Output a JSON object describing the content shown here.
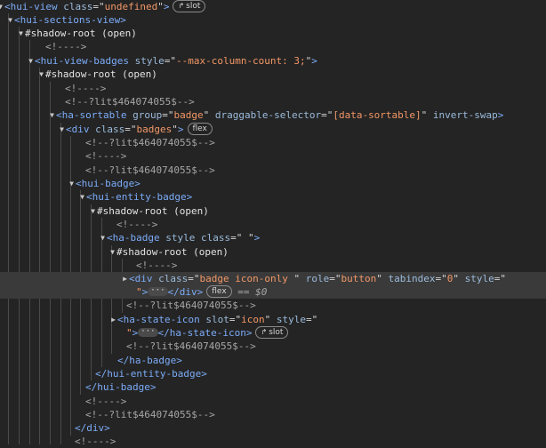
{
  "lines": [
    {
      "tri": "open",
      "parts": [
        {
          "c": "tag",
          "t": "<hui-view"
        },
        {
          "c": "attr",
          "t": " class"
        },
        {
          "c": "plain",
          "t": "=\""
        },
        {
          "c": "val",
          "t": "undefined"
        },
        {
          "c": "plain",
          "t": "\""
        },
        {
          "c": "tag",
          "t": ">"
        }
      ],
      "badge": "slot",
      "badge_icon": "↱"
    },
    {
      "tri": "open",
      "parts": [
        {
          "c": "tag",
          "t": "<hui-sections-view>"
        }
      ]
    },
    {
      "tri": "open",
      "parts": [
        {
          "c": "sr",
          "t": "#shadow-root (open)"
        }
      ]
    },
    {
      "tri": "",
      "parts": [
        {
          "c": "comment",
          "t": "<!---->"
        }
      ]
    },
    {
      "tri": "open",
      "parts": [
        {
          "c": "tag",
          "t": "<hui-view-badges"
        },
        {
          "c": "attr",
          "t": " style"
        },
        {
          "c": "plain",
          "t": "=\""
        },
        {
          "c": "val",
          "t": "--max-column-count: 3;"
        },
        {
          "c": "plain",
          "t": "\""
        },
        {
          "c": "tag",
          "t": ">"
        }
      ]
    },
    {
      "tri": "open",
      "parts": [
        {
          "c": "sr",
          "t": "#shadow-root (open)"
        }
      ]
    },
    {
      "tri": "",
      "parts": [
        {
          "c": "comment",
          "t": "<!---->"
        }
      ]
    },
    {
      "tri": "",
      "parts": [
        {
          "c": "comment",
          "t": "<!--?lit$464074055$-->"
        }
      ]
    },
    {
      "tri": "open",
      "parts": [
        {
          "c": "tag",
          "t": "<ha-sortable"
        },
        {
          "c": "attr",
          "t": " group"
        },
        {
          "c": "plain",
          "t": "=\""
        },
        {
          "c": "val",
          "t": "badge"
        },
        {
          "c": "plain",
          "t": "\""
        },
        {
          "c": "attr",
          "t": " draggable-selector"
        },
        {
          "c": "plain",
          "t": "=\""
        },
        {
          "c": "val",
          "t": "[data-sortable]"
        },
        {
          "c": "plain",
          "t": "\""
        },
        {
          "c": "attr",
          "t": " invert-swap"
        },
        {
          "c": "tag",
          "t": ">"
        }
      ]
    },
    {
      "tri": "open",
      "parts": [
        {
          "c": "tag",
          "t": "<div"
        },
        {
          "c": "attr",
          "t": " class"
        },
        {
          "c": "plain",
          "t": "=\""
        },
        {
          "c": "val",
          "t": "badges"
        },
        {
          "c": "plain",
          "t": "\""
        },
        {
          "c": "tag",
          "t": ">"
        }
      ],
      "badge": "flex"
    },
    {
      "tri": "",
      "parts": [
        {
          "c": "comment",
          "t": "<!--?lit$464074055$-->"
        }
      ]
    },
    {
      "tri": "",
      "parts": [
        {
          "c": "comment",
          "t": "<!---->"
        }
      ]
    },
    {
      "tri": "",
      "parts": [
        {
          "c": "comment",
          "t": "<!--?lit$464074055$-->"
        }
      ]
    },
    {
      "tri": "open",
      "parts": [
        {
          "c": "tag",
          "t": "<hui-badge>"
        }
      ]
    },
    {
      "tri": "open",
      "parts": [
        {
          "c": "tag",
          "t": "<hui-entity-badge>"
        }
      ]
    },
    {
      "tri": "open",
      "parts": [
        {
          "c": "sr",
          "t": "#shadow-root (open)"
        }
      ]
    },
    {
      "tri": "",
      "parts": [
        {
          "c": "comment",
          "t": "<!---->"
        }
      ]
    },
    {
      "tri": "open",
      "parts": [
        {
          "c": "tag",
          "t": "<ha-badge"
        },
        {
          "c": "attr",
          "t": " style"
        },
        {
          "c": "attr",
          "t": " class"
        },
        {
          "c": "plain",
          "t": "=\""
        },
        {
          "c": "val",
          "t": "  "
        },
        {
          "c": "plain",
          "t": "\""
        },
        {
          "c": "tag",
          "t": ">"
        }
      ]
    },
    {
      "tri": "open",
      "parts": [
        {
          "c": "sr",
          "t": "#shadow-root (open)"
        }
      ]
    },
    {
      "tri": "",
      "parts": [
        {
          "c": "comment",
          "t": "<!---->"
        }
      ]
    },
    {
      "tri": "closed",
      "selected": true,
      "parts": [
        {
          "c": "tag",
          "t": "<div"
        },
        {
          "c": "attr",
          "t": " class"
        },
        {
          "c": "plain",
          "t": "=\""
        },
        {
          "c": "val",
          "t": "badge  icon-only "
        },
        {
          "c": "plain",
          "t": "\""
        },
        {
          "c": "attr",
          "t": " role"
        },
        {
          "c": "plain",
          "t": "=\""
        },
        {
          "c": "val",
          "t": "button"
        },
        {
          "c": "plain",
          "t": "\""
        },
        {
          "c": "attr",
          "t": " tabindex"
        },
        {
          "c": "plain",
          "t": "=\""
        },
        {
          "c": "val",
          "t": "0"
        },
        {
          "c": "plain",
          "t": "\""
        },
        {
          "c": "attr",
          "t": " style"
        },
        {
          "c": "plain",
          "t": "=\""
        }
      ]
    },
    {
      "tri": "",
      "selected": true,
      "parts": [
        {
          "c": "val",
          "t": "\""
        },
        {
          "c": "tag",
          "t": ">"
        },
        {
          "c": "ellipsis",
          "t": "···"
        },
        {
          "c": "tag",
          "t": "</div>"
        }
      ],
      "badge": "flex",
      "suffix": " == $0"
    },
    {
      "tri": "",
      "parts": [
        {
          "c": "comment",
          "t": "<!--?lit$464074055$-->"
        }
      ]
    },
    {
      "tri": "closed",
      "parts": [
        {
          "c": "tag",
          "t": "<ha-state-icon"
        },
        {
          "c": "attr",
          "t": " slot"
        },
        {
          "c": "plain",
          "t": "=\""
        },
        {
          "c": "val",
          "t": "icon"
        },
        {
          "c": "plain",
          "t": "\""
        },
        {
          "c": "attr",
          "t": " style"
        },
        {
          "c": "plain",
          "t": "=\""
        }
      ]
    },
    {
      "tri": "",
      "parts": [
        {
          "c": "val",
          "t": "\""
        },
        {
          "c": "tag",
          "t": ">"
        },
        {
          "c": "ellipsis",
          "t": "···"
        },
        {
          "c": "tag",
          "t": "</ha-state-icon>"
        }
      ],
      "badge": "slot",
      "badge_icon": "↱"
    },
    {
      "tri": "",
      "parts": [
        {
          "c": "comment",
          "t": "<!--?lit$464074055$-->"
        }
      ]
    },
    {
      "tri": "",
      "parts": [
        {
          "c": "tag",
          "t": "</ha-badge>"
        }
      ]
    },
    {
      "tri": "",
      "parts": [
        {
          "c": "tag",
          "t": "</hui-entity-badge>"
        }
      ]
    },
    {
      "tri": "",
      "parts": [
        {
          "c": "tag",
          "t": "</hui-badge>"
        }
      ]
    },
    {
      "tri": "",
      "parts": [
        {
          "c": "comment",
          "t": "<!---->"
        }
      ]
    },
    {
      "tri": "",
      "parts": [
        {
          "c": "comment",
          "t": "<!--?lit$464074055$-->"
        }
      ]
    },
    {
      "tri": "",
      "parts": [
        {
          "c": "tag",
          "t": "</div>"
        }
      ]
    },
    {
      "tri": "",
      "parts": [
        {
          "c": "comment",
          "t": "<!---->"
        }
      ]
    }
  ],
  "icons": {
    "open": "▼",
    "closed": "▶"
  }
}
